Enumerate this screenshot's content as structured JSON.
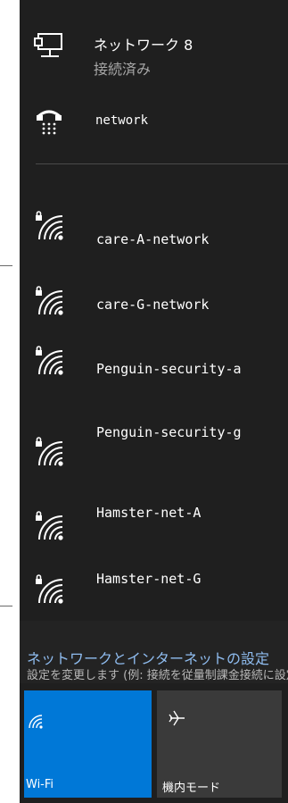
{
  "wired": {
    "title": "ネットワーク 8",
    "status": "接続済み"
  },
  "dialup": {
    "label": "network"
  },
  "wifi_networks": [
    {
      "name": "care-A-network"
    },
    {
      "name": "care-G-network"
    },
    {
      "name": "Penguin-security-a"
    },
    {
      "name": "Penguin-security-g"
    },
    {
      "name": "Hamster-net-A"
    },
    {
      "name": "Hamster-net-G"
    }
  ],
  "settings_link": {
    "title": "ネットワークとインターネットの設定",
    "description": "設定を変更します (例: 接続を従量制課金接続に設定する)"
  },
  "quick_actions": [
    {
      "label": "Wi-Fi",
      "icon": "wifi-icon",
      "active": true,
      "color": "#0078d7"
    },
    {
      "label": "機内モード",
      "icon": "airplane-icon",
      "active": false,
      "color": "#3a3a3a"
    }
  ]
}
